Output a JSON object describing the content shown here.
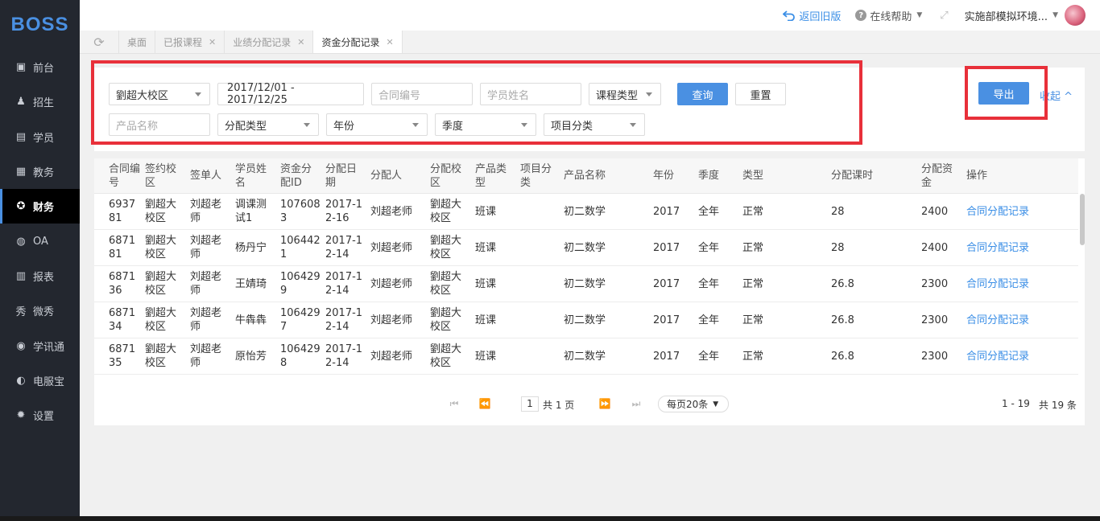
{
  "app": {
    "logo": "BOSS"
  },
  "sidebar": {
    "items": [
      {
        "label": "前台",
        "icon": "calendar-icon"
      },
      {
        "label": "招生",
        "icon": "user-add-icon"
      },
      {
        "label": "学员",
        "icon": "id-card-icon"
      },
      {
        "label": "教务",
        "icon": "book-icon"
      },
      {
        "label": "财务",
        "icon": "finance-icon",
        "active": true
      },
      {
        "label": "OA",
        "icon": "chat-icon"
      },
      {
        "label": "报表",
        "icon": "bar-chart-icon"
      },
      {
        "label": "微秀",
        "icon": "show-icon"
      },
      {
        "label": "学讯通",
        "icon": "location-icon"
      },
      {
        "label": "电服宝",
        "icon": "phone-icon"
      },
      {
        "label": "设置",
        "icon": "gear-icon"
      }
    ]
  },
  "topbar": {
    "back_label": "返回旧版",
    "help_label": "在线帮助",
    "user_label": "实施部模拟环境..."
  },
  "tabs": [
    {
      "label": "桌面",
      "closable": false
    },
    {
      "label": "已报课程",
      "closable": true
    },
    {
      "label": "业绩分配记录",
      "closable": true
    },
    {
      "label": "资金分配记录",
      "closable": true,
      "active": true
    }
  ],
  "filters": {
    "campus": "劉超大校区",
    "date_range": "2017/12/01 - 2017/12/25",
    "contract_no_placeholder": "合同编号",
    "student_name_placeholder": "学员姓名",
    "course_type": "课程类型",
    "query_label": "查询",
    "reset_label": "重置",
    "product_name_placeholder": "产品名称",
    "alloc_type": "分配类型",
    "year": "年份",
    "season": "季度",
    "project_category": "项目分类",
    "export_label": "导出",
    "collapse_label": "收起 ^"
  },
  "table": {
    "headers": [
      "合同编号",
      "签约校区",
      "签单人",
      "学员姓名",
      "资金分配ID",
      "分配日期",
      "分配人",
      "分配校区",
      "产品类型",
      "项目分类",
      "产品名称",
      "年份",
      "季度",
      "类型",
      "分配课时",
      "分配资金",
      "操作"
    ],
    "rows": [
      [
        "693781",
        "劉超大校区",
        "刘超老师",
        "调课测试1",
        "1076083",
        "2017-12-16",
        "刘超老师",
        "劉超大校区",
        "班课",
        "",
        "初二数学",
        "2017",
        "全年",
        "正常",
        "28",
        "2400",
        "合同分配记录"
      ],
      [
        "687181",
        "劉超大校区",
        "刘超老师",
        "杨丹宁",
        "1064421",
        "2017-12-14",
        "刘超老师",
        "劉超大校区",
        "班课",
        "",
        "初二数学",
        "2017",
        "全年",
        "正常",
        "28",
        "2400",
        "合同分配记录"
      ],
      [
        "687136",
        "劉超大校区",
        "刘超老师",
        "王婧琦",
        "1064299",
        "2017-12-14",
        "刘超老师",
        "劉超大校区",
        "班课",
        "",
        "初二数学",
        "2017",
        "全年",
        "正常",
        "26.8",
        "2300",
        "合同分配记录"
      ],
      [
        "687134",
        "劉超大校区",
        "刘超老师",
        "牛犇犇",
        "1064297",
        "2017-12-14",
        "刘超老师",
        "劉超大校区",
        "班课",
        "",
        "初二数学",
        "2017",
        "全年",
        "正常",
        "26.8",
        "2300",
        "合同分配记录"
      ],
      [
        "687135",
        "劉超大校区",
        "刘超老师",
        "原怡芳",
        "1064298",
        "2017-12-14",
        "刘超老师",
        "劉超大校区",
        "班课",
        "",
        "初二数学",
        "2017",
        "全年",
        "正常",
        "26.8",
        "2300",
        "合同分配记录"
      ]
    ]
  },
  "pagination": {
    "current_page": "1",
    "total_pages_label": "共 1 页",
    "page_size_label": "每页20条",
    "range_label": "1 - 19",
    "total_label": "共 19 条"
  }
}
